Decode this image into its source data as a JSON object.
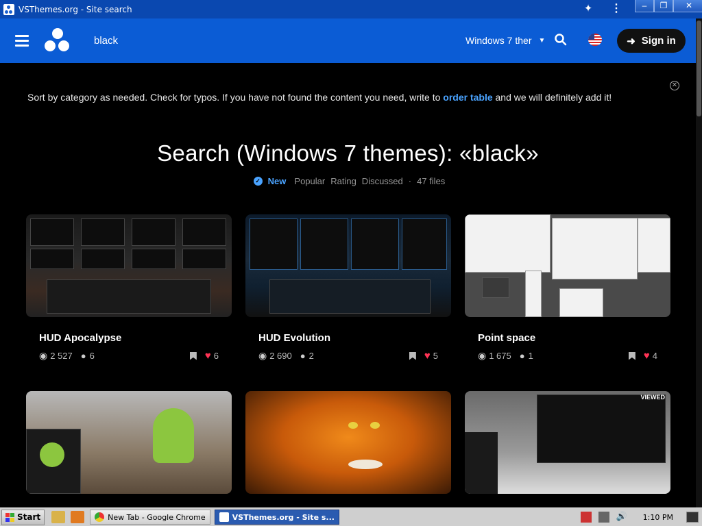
{
  "window": {
    "title": "VSThemes.org - Site search",
    "minimize": "–",
    "restore": "❐",
    "close": "✕"
  },
  "header": {
    "search_query": "black",
    "category": "Windows 7 ther",
    "signin_label": "Sign in"
  },
  "notice": {
    "text_before": "Sort by category as needed. Check for typos. If you have not found the content you need, write to",
    "link": "order table",
    "text_after": "and we will definitely add it!"
  },
  "page": {
    "heading": "Search (Windows 7 themes): «black»",
    "sort": {
      "active": "New",
      "options": [
        "Popular",
        "Rating",
        "Discussed"
      ],
      "separator": "·",
      "count": "47 files"
    }
  },
  "cards": [
    {
      "title": "HUD Apocalypse",
      "views": "2 527",
      "comments": "6",
      "likes": "6"
    },
    {
      "title": "HUD Evolution",
      "views": "2 690",
      "comments": "2",
      "likes": "5"
    },
    {
      "title": "Point space",
      "views": "1 675",
      "comments": "1",
      "likes": "4"
    },
    {
      "title": "",
      "views": "",
      "comments": "",
      "likes": ""
    },
    {
      "title": "",
      "views": "",
      "comments": "",
      "likes": ""
    },
    {
      "title": "",
      "views": "",
      "comments": "",
      "likes": "",
      "badge": "VIEWED"
    }
  ],
  "taskbar": {
    "start": "Start",
    "tasks": [
      "New Tab - Google Chrome",
      "VSThemes.org - Site s..."
    ],
    "clock": "1:10 PM"
  },
  "colors": {
    "header_blue": "#0b5cd5",
    "titlebar_blue": "#0a48b0",
    "link_blue": "#4aa3ff",
    "heart_red": "#ff3355"
  }
}
